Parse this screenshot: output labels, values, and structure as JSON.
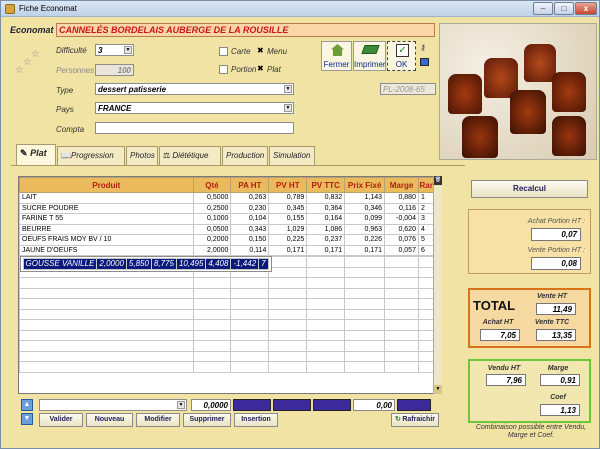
{
  "window": {
    "title": "Fiche Economat",
    "minimize": "–",
    "maximize": "□",
    "close": "x"
  },
  "header": {
    "economat_label": "Economat",
    "product_name": "CANNELÉS BORDELAIS AUBERGE DE LA ROUSILLE"
  },
  "form": {
    "difficulte_label": "Difficulté",
    "difficulte_value": "3",
    "personnes_label": "Personnes",
    "personnes_value": "100",
    "type_label": "Type",
    "type_value": "dessert patisserie",
    "pays_label": "Pays",
    "pays_value": "FRANCE",
    "compta_label": "Compta",
    "compta_value": "",
    "reference": "PL-2008-65",
    "carte_label": "Carte",
    "menu_label": "Menu",
    "portion_label": "Portion",
    "plat_label": "Plat"
  },
  "toolbar": {
    "fermer": "Fermer",
    "imprimer": "Imprimer",
    "ok": "OK"
  },
  "tabs": [
    "Plat",
    "Progression",
    "Photos",
    "Diététique",
    "Production",
    "Simulation"
  ],
  "table": {
    "headers": [
      "Produit",
      "Qté",
      "PA HT",
      "PV HT",
      "PV TTC",
      "Prix Fixé",
      "Marge",
      "Rang"
    ],
    "rows": [
      [
        "LAIT",
        "0,5000",
        "0,263",
        "0,789",
        "0,832",
        "1,143",
        "0,880",
        "1"
      ],
      [
        "SUCRE POUDRE",
        "0,2500",
        "0,230",
        "0,345",
        "0,364",
        "0,346",
        "0,116",
        "2"
      ],
      [
        "FARINE T 55",
        "0,1000",
        "0,104",
        "0,155",
        "0,164",
        "0,099",
        "-0,004",
        "3"
      ],
      [
        "BEURRE",
        "0,0500",
        "0,343",
        "1,029",
        "1,086",
        "0,963",
        "0,620",
        "4"
      ],
      [
        "OEUFS FRAIS MOY BV / 10",
        "0,2000",
        "0,150",
        "0,225",
        "0,237",
        "0,226",
        "0,076",
        "5"
      ],
      [
        "JAUNE D'OEUFS",
        "2,0000",
        "0,114",
        "0,171",
        "0,171",
        "0,171",
        "0,057",
        "6"
      ],
      [
        "GOUSSE VANILLE",
        "2,0000",
        "5,850",
        "8,775",
        "10,495",
        "4,408",
        "-1,442",
        "7"
      ]
    ]
  },
  "footer": {
    "qte_total": "0,0000",
    "prix_total": "0,00"
  },
  "buttons": {
    "valider": "Valider",
    "nouveau": "Nouveau",
    "modifier": "Modifier",
    "supprimer": "Supprimer",
    "insertion": "Insertion",
    "rafraichir": "Rafraichir",
    "recalcul": "Recalcul"
  },
  "portion": {
    "achat_label": "Achat Portion HT :",
    "achat_value": "0,07",
    "vente_label": "Vente Portion HT :",
    "vente_value": "0,08"
  },
  "total": {
    "title": "TOTAL",
    "vente_ht_label": "Vente HT",
    "vente_ht_value": "11,49",
    "achat_ht_label": "Achat HT",
    "achat_ht_value": "7,05",
    "vente_ttc_label": "Vente TTC",
    "vente_ttc_value": "13,35"
  },
  "combo": {
    "vendu_label": "Vendu HT",
    "vendu_value": "7,96",
    "marge_label": "Marge",
    "marge_value": "0,91",
    "coef_label": "Coef",
    "coef_value": "1,13",
    "note": "Combinaison possible entre Vendu, Marge et Coef."
  }
}
